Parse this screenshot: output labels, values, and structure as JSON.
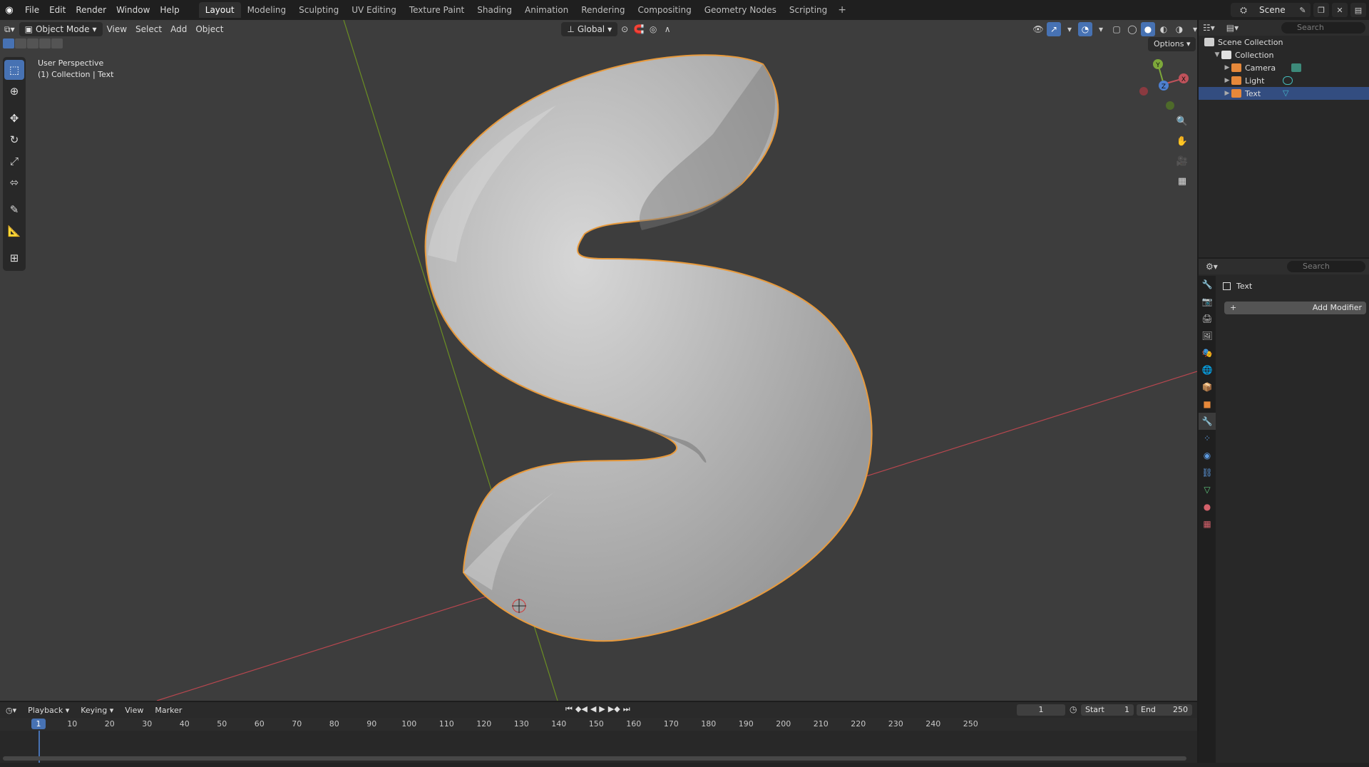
{
  "top_menu": [
    "File",
    "Edit",
    "Render",
    "Window",
    "Help"
  ],
  "workspaces": [
    "Layout",
    "Modeling",
    "Sculpting",
    "UV Editing",
    "Texture Paint",
    "Shading",
    "Animation",
    "Rendering",
    "Compositing",
    "Geometry Nodes",
    "Scripting"
  ],
  "active_workspace": "Layout",
  "scene_name": "Scene",
  "viewport": {
    "mode": "Object Mode",
    "menus": [
      "View",
      "Select",
      "Add",
      "Object"
    ],
    "transform_orientation": "Global",
    "options_label": "Options",
    "info_line1": "User Perspective",
    "info_line2": "(1) Collection | Text",
    "tools": [
      "select-box",
      "cursor",
      "move",
      "rotate",
      "scale",
      "transform",
      "annotate",
      "measure",
      "add-cube"
    ],
    "gizmo_axes": {
      "x": "X",
      "y": "Y",
      "z": "Z"
    }
  },
  "outliner": {
    "search_placeholder": "Search",
    "root": "Scene Collection",
    "collection": "Collection",
    "items": [
      {
        "name": "Camera",
        "color": "#e6883a"
      },
      {
        "name": "Light",
        "color": "#e6883a"
      },
      {
        "name": "Text",
        "color": "#e6883a"
      }
    ],
    "selected": "Text"
  },
  "properties": {
    "search_placeholder": "Search",
    "object_name": "Text",
    "add_modifier": "Add Modifier",
    "active_tab": "modifiers"
  },
  "timeline": {
    "menus": [
      "Playback",
      "Keying",
      "View",
      "Marker"
    ],
    "current_frame": "1",
    "start_label": "Start",
    "start_value": "1",
    "end_label": "End",
    "end_value": "250",
    "ticks": [
      "10",
      "20",
      "30",
      "40",
      "50",
      "60",
      "70",
      "80",
      "90",
      "100",
      "110",
      "120",
      "130",
      "140",
      "150",
      "160",
      "170",
      "180",
      "190",
      "200",
      "210",
      "220",
      "230",
      "240",
      "250"
    ]
  },
  "colors": {
    "accent": "#4772b3",
    "selection_outline": "#e89a3c",
    "viewport_bg": "#3d3d3d",
    "axis_x": "#b8474f",
    "axis_y": "#6b8e23"
  }
}
